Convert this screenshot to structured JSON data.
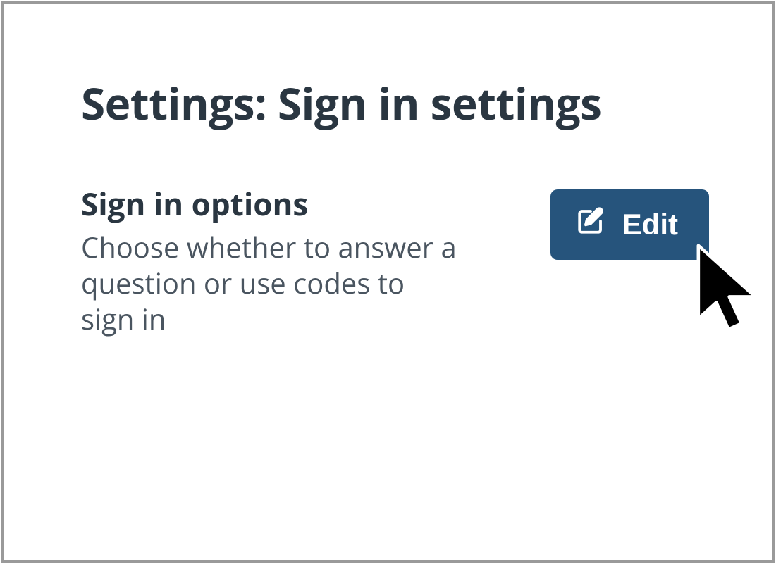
{
  "page": {
    "title": "Settings: Sign in settings"
  },
  "section": {
    "title": "Sign in options",
    "description": "Choose whether to answer a question or use codes to sign in"
  },
  "actions": {
    "edit_label": "Edit"
  },
  "colors": {
    "button_bg": "#26547c",
    "text_heading": "#2a3641",
    "text_body": "#4a5560",
    "frame_border": "#9a9a9a"
  }
}
